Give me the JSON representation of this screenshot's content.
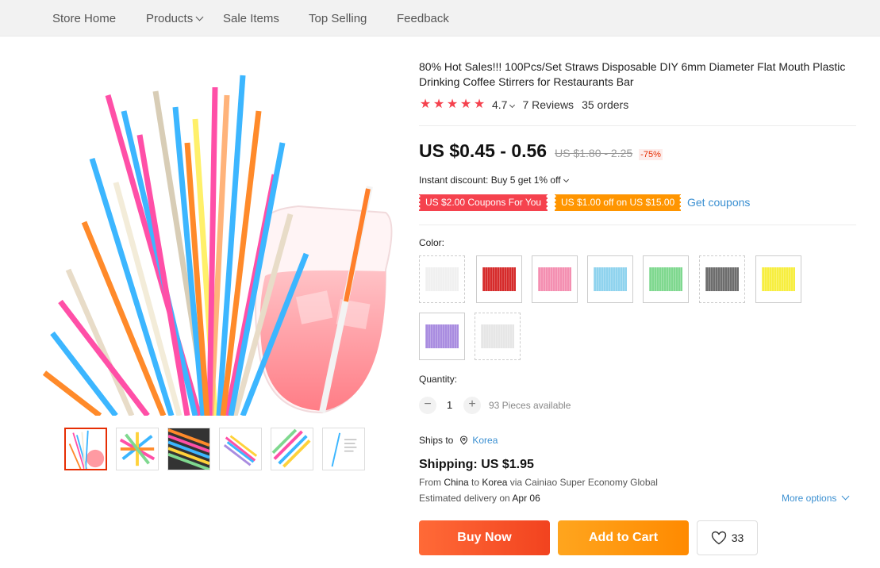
{
  "nav": {
    "items": [
      "Store Home",
      "Products",
      "Sale Items",
      "Top Selling",
      "Feedback"
    ]
  },
  "product": {
    "title": "80% Hot Sales!!! 100Pcs/Set Straws Disposable DIY 6mm Diameter Flat Mouth Plastic Drinking Coffee Stirrers for Restaurants Bar",
    "rating": "4.7",
    "stars": 5,
    "reviews": "7 Reviews",
    "orders": "35 orders",
    "price": "US $0.45 - 0.56",
    "old_price": "US $1.80 - 2.25",
    "discount": "-75%",
    "instant_discount": "Instant discount: Buy 5 get 1% off",
    "coupons": [
      "US $2.00 Coupons For You",
      "US $1.00 off on US $15.00"
    ],
    "get_coupons": "Get coupons"
  },
  "color": {
    "label": "Color:",
    "swatches": [
      {
        "name": "white",
        "hex": "#f0f0f0"
      },
      {
        "name": "red",
        "hex": "#d62b2b"
      },
      {
        "name": "pink",
        "hex": "#f48fb1"
      },
      {
        "name": "light-blue",
        "hex": "#8fd3ee"
      },
      {
        "name": "green",
        "hex": "#7fd88f"
      },
      {
        "name": "gray",
        "hex": "#6d6d6d"
      },
      {
        "name": "yellow",
        "hex": "#f7ee3f"
      },
      {
        "name": "purple",
        "hex": "#a98ce0"
      },
      {
        "name": "clear",
        "hex": "#e6e6e6"
      }
    ]
  },
  "quantity": {
    "label": "Quantity:",
    "minus": "−",
    "plus": "+",
    "value": "1",
    "available": "93 Pieces available"
  },
  "shipping": {
    "ships_to_label": "Ships to",
    "ships_to_country": "Korea",
    "cost": "Shipping: US $1.95",
    "from_prefix": "From ",
    "from_country": "China",
    "to_word": " to ",
    "to_country": "Korea",
    "via_text": " via Cainiao Super Economy Global",
    "eta_prefix": "Estimated delivery on ",
    "eta_date": "Apr 06",
    "more_options": "More options"
  },
  "actions": {
    "buy_now": "Buy Now",
    "add_to_cart": "Add to Cart",
    "wishlist_count": "33"
  },
  "colors": {
    "accent_red": "#f5424e",
    "price_red": "#e62e04",
    "link_blue": "#3a8fd1",
    "buy_gradient": "#f2431f",
    "cart_gradient": "#ff8a00"
  }
}
